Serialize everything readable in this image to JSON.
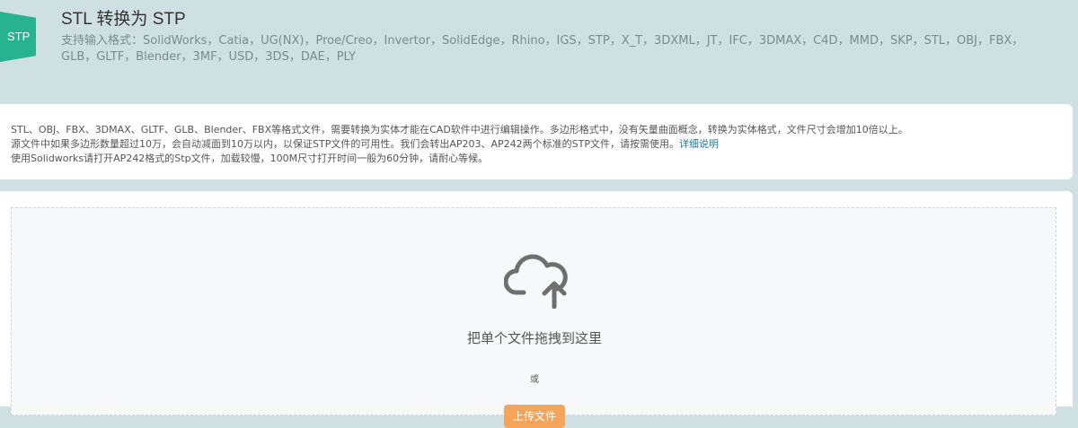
{
  "header": {
    "logo_text": "STP",
    "title": "STL 转换为 STP",
    "formats": "支持输入格式：SolidWorks，Catia，UG(NX)，Proe/Creo，Invertor，SolidEdge，Rhino，IGS，STP，X_T，3DXML，JT，IFC，3DMAX，C4D，MMD，SKP，STL，OBJ，FBX，GLB，GLTF，Blender，3MF，USD，3DS，DAE，PLY"
  },
  "info": {
    "line1": "STL、OBJ、FBX、3DMAX、GLTF、GLB、Blender、FBX等格式文件，需要转换为实体才能在CAD软件中进行编辑操作。多边形格式中，没有矢量曲面概念，转换为实体格式，文件尺寸会增加10倍以上。",
    "line2": "源文件中如果多边形数量超过10万，会自动减面到10万以内，以保证STP文件的可用性。我们会转出AP203、AP242两个标准的STP文件，请按需使用。",
    "details_link": "详细说明",
    "line3": "使用Solidworks请打开AP242格式的Stp文件，加载较慢，100M尺寸打开时间一般为60分钟，请耐心等候。"
  },
  "upload": {
    "drop_text": "把单个文件拖拽到这里",
    "or_text": "或",
    "button_label": "上传文件"
  },
  "colors": {
    "accent": "#27b38f",
    "button": "#f5a55a",
    "link": "#1f7a9a"
  }
}
